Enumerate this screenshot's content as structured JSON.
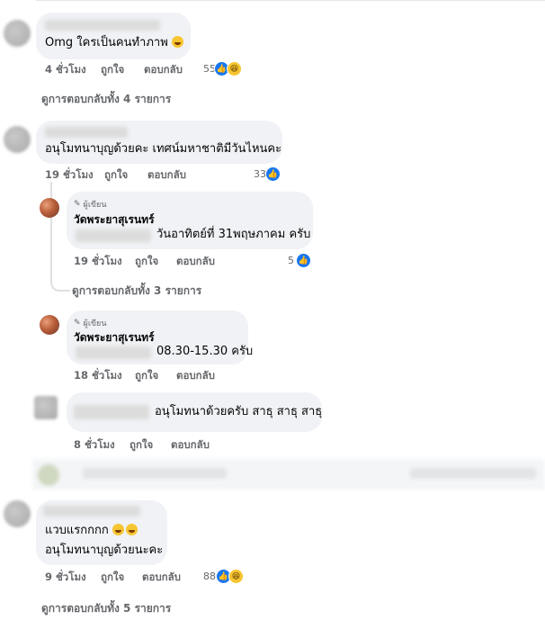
{
  "comments": [
    {
      "text": "Omg ใครเป็นคนทำภาพ",
      "time": "4 ชั่วโมง",
      "like": "ถูกใจ",
      "reply": "ตอบกลับ",
      "count": "55",
      "view_replies": "ดูการตอบกลับทั้ง 4 รายการ"
    },
    {
      "text": "อนุโมทนาบุญด้วยคะ เทศน์มหาชาติมีวันไหนคะ",
      "time": "19 ชั่วโมง",
      "like": "ถูกใจ",
      "reply": "ตอบกลับ",
      "count": "33",
      "replies": [
        {
          "author_badge": "ผู้เขียน",
          "name": "วัดพระยาสุเรนทร์",
          "text": "วันอาทิตย์ที่ 31พฤษภาคม ครับ",
          "time": "19 ชั่วโมง",
          "like": "ถูกใจ",
          "reply": "ตอบกลับ",
          "count": "5"
        }
      ],
      "view_replies": "ดูการตอบกลับทั้ง 3 รายการ",
      "replies_after": [
        {
          "author_badge": "ผู้เขียน",
          "name": "วัดพระยาสุเรนทร์",
          "text": "08.30-15.30 ครับ",
          "time": "18 ชั่วโมง",
          "like": "ถูกใจ",
          "reply": "ตอบกลับ"
        },
        {
          "text": "อนุโมทนาด้วยครับ สาธุ สาธุ สาธุ",
          "time": "8 ชั่วโมง",
          "like": "ถูกใจ",
          "reply": "ตอบกลับ"
        }
      ]
    },
    {
      "line1": "แวบแรกกกก",
      "line2": "อนุโมทนาบุญด้วยนะคะ",
      "time": "9 ชั่วโมง",
      "like": "ถูกใจ",
      "reply": "ตอบกลับ",
      "count": "88",
      "view_replies": "ดูการตอบกลับทั้ง 5 รายการ"
    }
  ],
  "icons": {
    "like": "thumbs-up-icon",
    "haha": "laughing-face-icon",
    "pencil": "pencil-icon"
  },
  "colors": {
    "bubble": "#f0f2f5",
    "meta": "#65676b",
    "like_blue": "#1877f2",
    "haha_yellow": "#f7c531"
  }
}
